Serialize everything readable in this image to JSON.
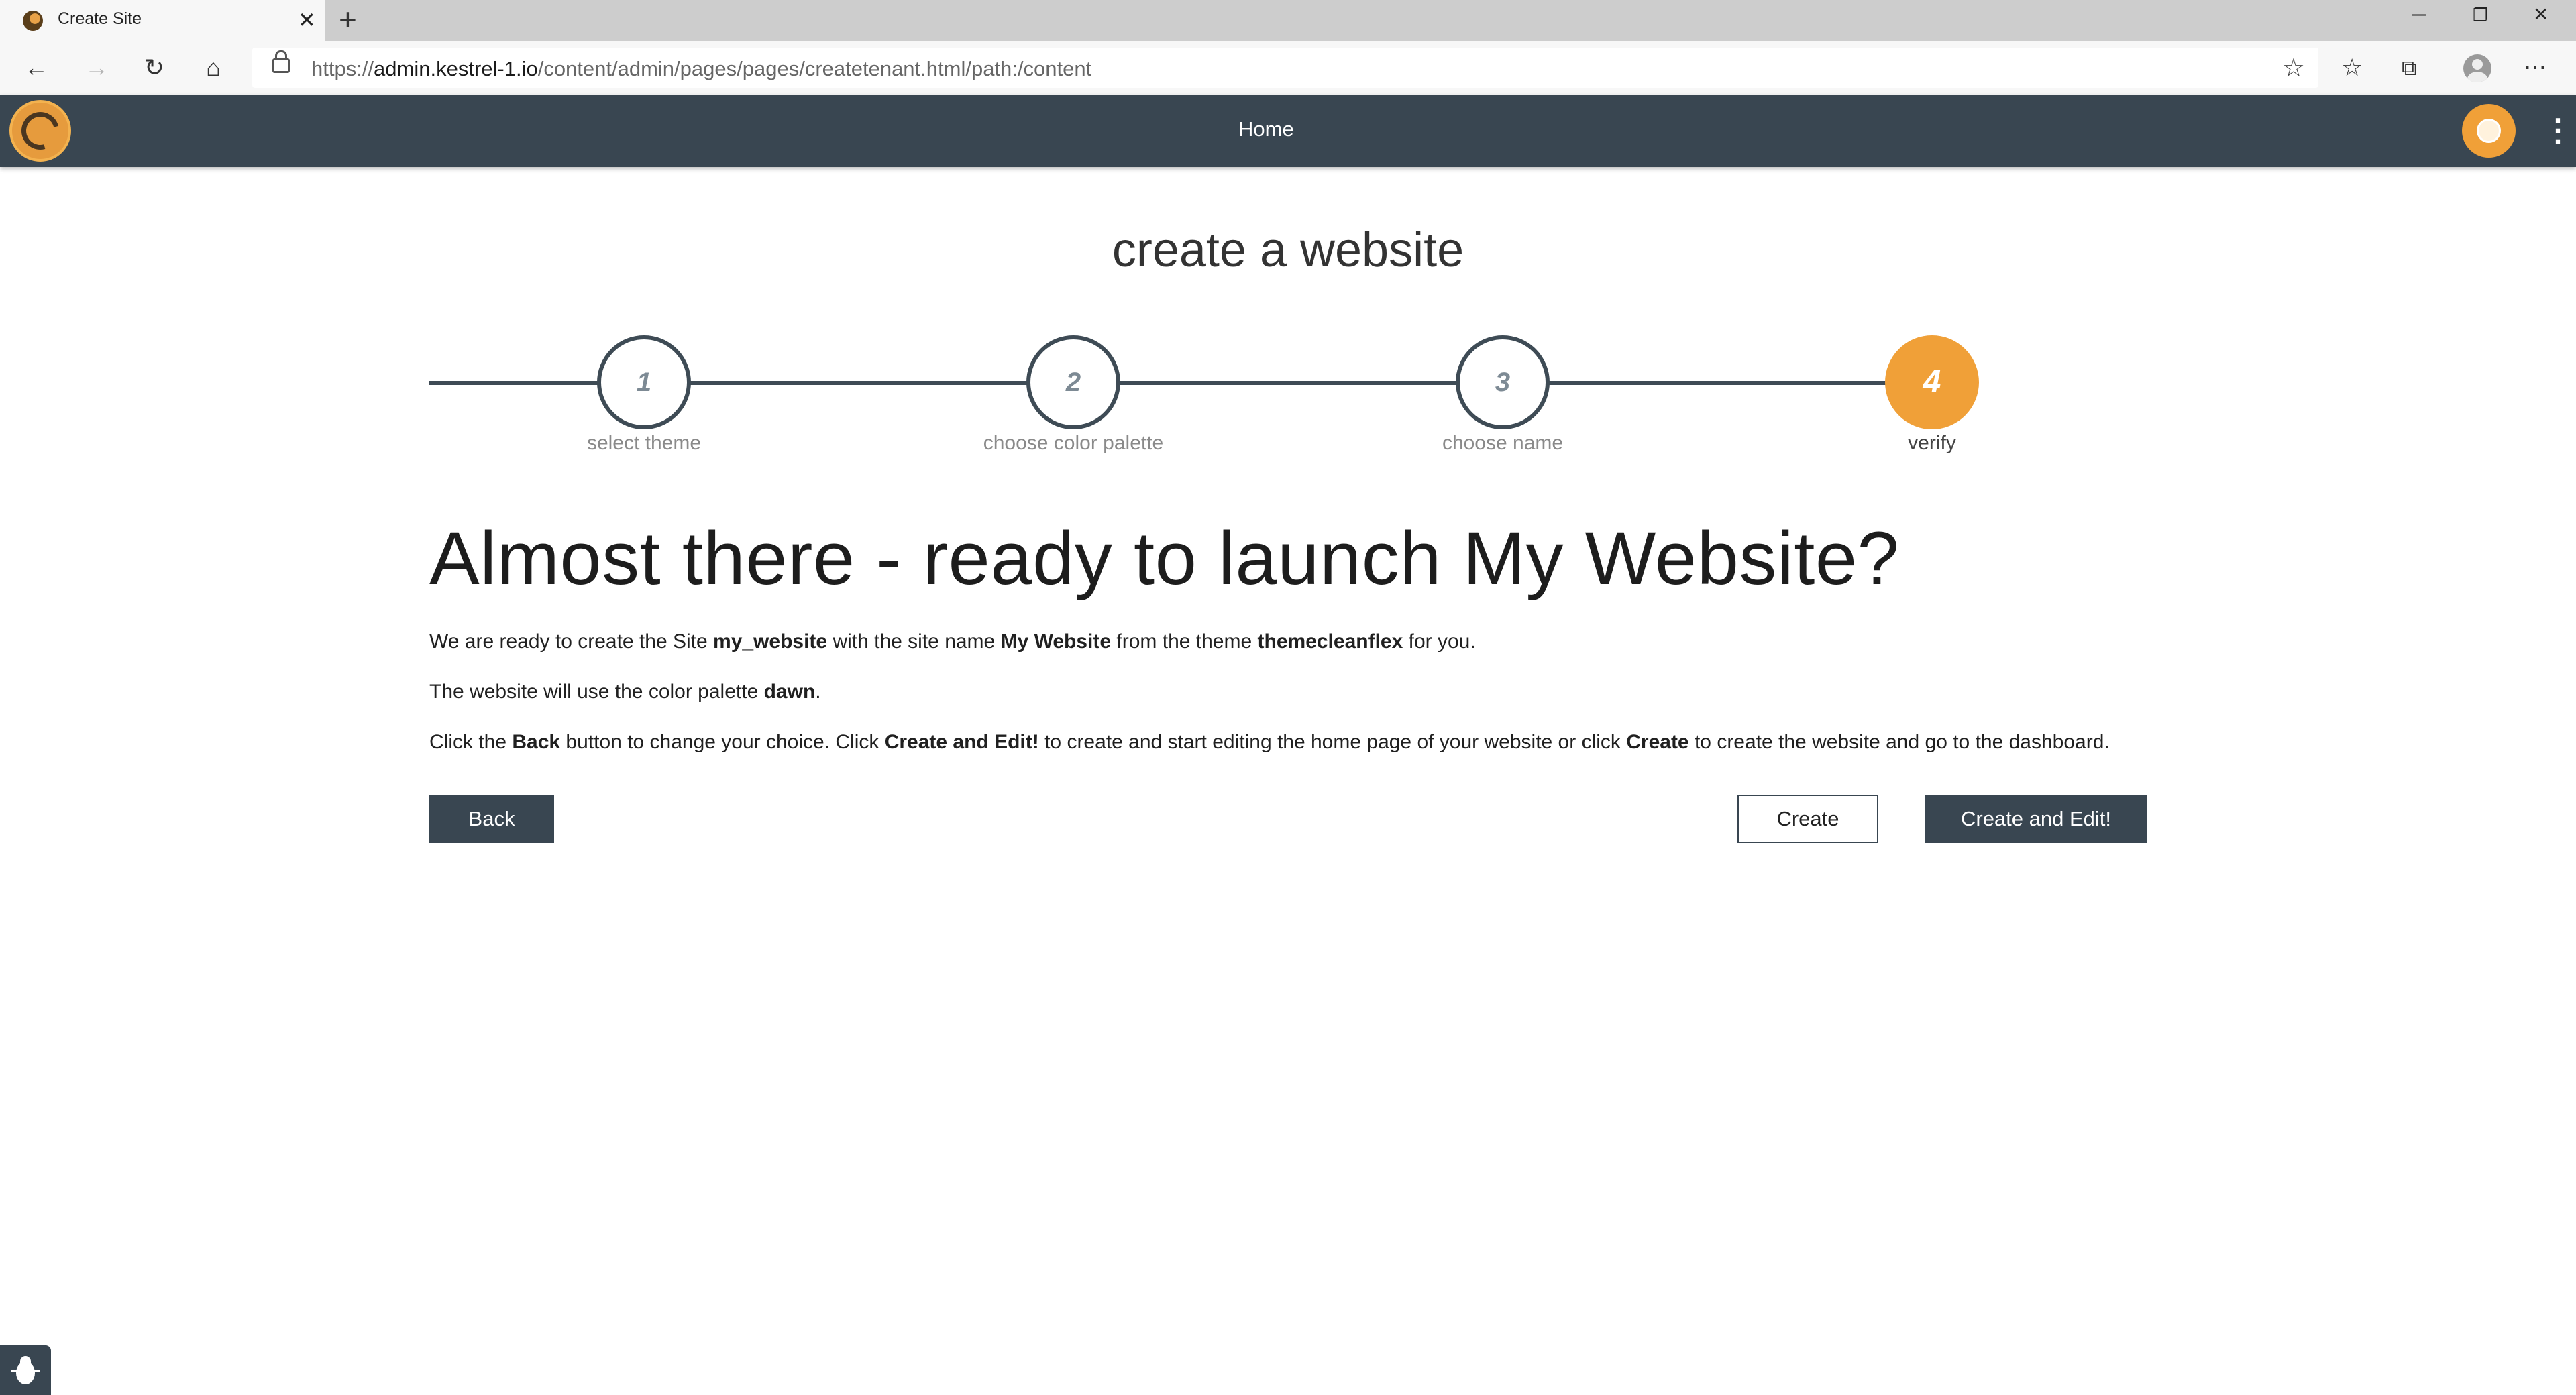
{
  "browser": {
    "tab_title": "Create Site",
    "new_tab_glyph": "+",
    "url_scheme": "https://",
    "url_host": "admin.kestrel-1.io",
    "url_path": "/content/admin/pages/pages/createtenant.html/path:/content",
    "window_controls": [
      "minimize",
      "restore",
      "close"
    ]
  },
  "header": {
    "home_label": "Home"
  },
  "page": {
    "title": "create a website",
    "steps": [
      {
        "number": "1",
        "label": "select theme",
        "active": false
      },
      {
        "number": "2",
        "label": "choose color palette",
        "active": false
      },
      {
        "number": "3",
        "label": "choose name",
        "active": false
      },
      {
        "number": "4",
        "label": "verify",
        "active": true
      }
    ],
    "headline": "Almost there - ready to launch My Website?",
    "p1": {
      "t1": "We are ready to create the Site ",
      "site_id": "my_website",
      "t2": " with the site name ",
      "site_name": "My Website",
      "t3": " from the theme ",
      "theme": "themecleanflex",
      "t4": " for you."
    },
    "p2": {
      "t1": "The website will use the color palette ",
      "palette": "dawn",
      "t2": "."
    },
    "p3": {
      "t1": "Click the ",
      "back": "Back",
      "t2": " button to change your choice. Click ",
      "create_edit": "Create and Edit!",
      "t3": " to create and start editing the home page of your website or click ",
      "create": "Create",
      "t4": " to create the website and go to the dashboard."
    },
    "buttons": {
      "back": "Back",
      "create": "Create",
      "create_edit": "Create and Edit!"
    }
  },
  "colors": {
    "header_bg": "#394651",
    "accent": "#f0a038"
  }
}
